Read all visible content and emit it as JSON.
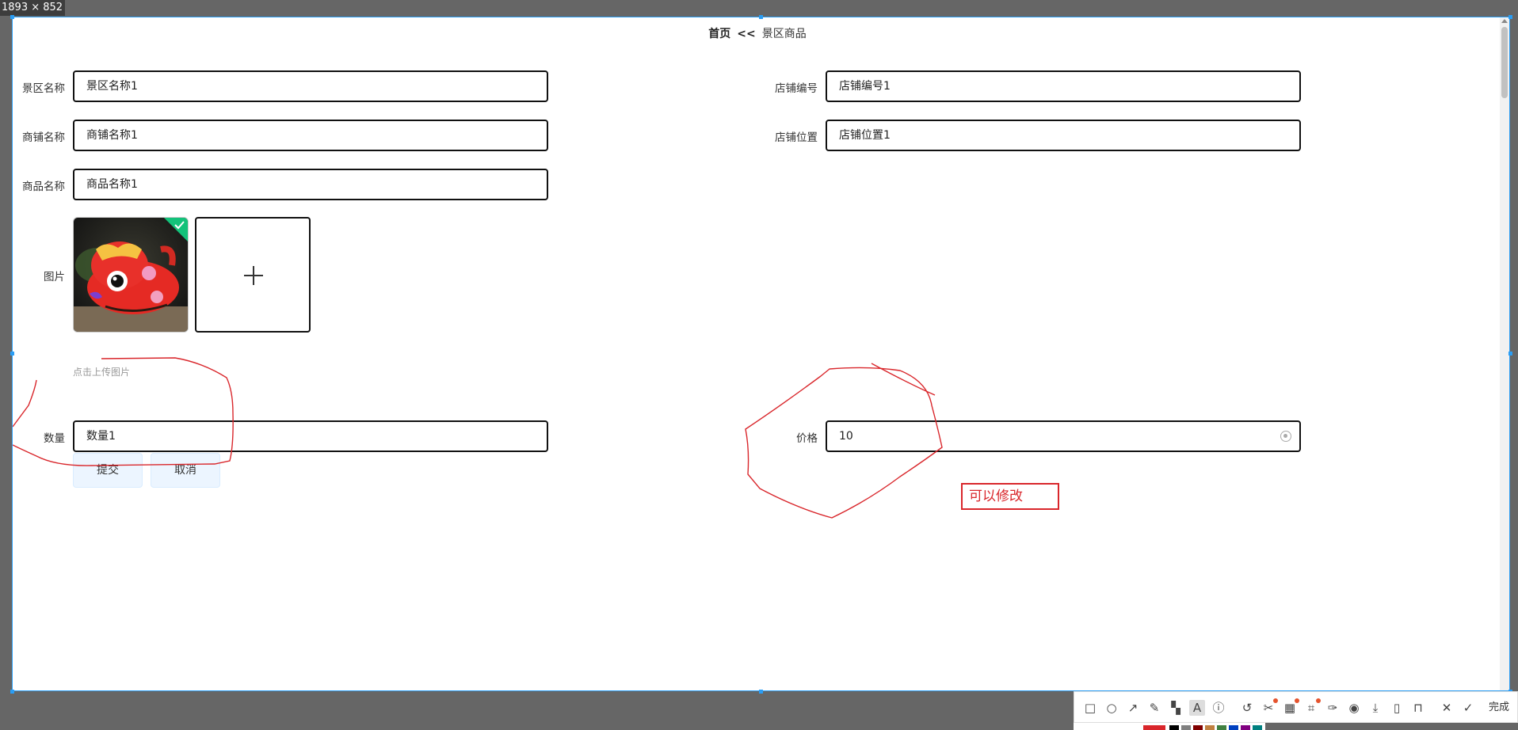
{
  "screen": {
    "size_tag": "1893 × 852"
  },
  "breadcrumb": {
    "home": "首页",
    "separator": "<<",
    "current": "景区商品"
  },
  "form": {
    "scenic_name_label": "景区名称",
    "scenic_name_value": "景区名称1",
    "store_no_label": "店铺编号",
    "store_no_value": "店铺编号1",
    "shop_name_label": "商铺名称",
    "shop_name_value": "商铺名称1",
    "store_location_label": "店铺位置",
    "store_location_value": "店铺位置1",
    "product_name_label": "商品名称",
    "product_name_value": "商品名称1",
    "image_label": "图片",
    "upload_hint": "点击上传图片",
    "quantity_label": "数量",
    "quantity_value": "数量1",
    "price_label": "价格",
    "price_value": "10"
  },
  "buttons": {
    "submit": "提交",
    "cancel": "取消"
  },
  "annotation": {
    "text": "可以修改",
    "color": "#d9262b"
  },
  "toolbar": {
    "done_label": "完成",
    "tools": [
      "rectangle-icon",
      "ellipse-icon",
      "arrow-icon",
      "pen-icon",
      "mosaic-icon",
      "text-icon",
      "number-icon",
      "undo-icon",
      "redo-icon",
      "ocr-icon",
      "scroll-capture-icon",
      "pin-icon",
      "record-icon",
      "save-icon",
      "copy-icon",
      "bookmark-icon",
      "close-icon",
      "check-icon"
    ],
    "palette": [
      "#d9262b",
      "#000000",
      "#808080",
      "#800000",
      "#c08040",
      "#408040",
      "#0040c0",
      "#800080",
      "#008080"
    ]
  },
  "colors": {
    "selection_border": "#2a9df4",
    "button_bg": "#ecf5ff"
  }
}
